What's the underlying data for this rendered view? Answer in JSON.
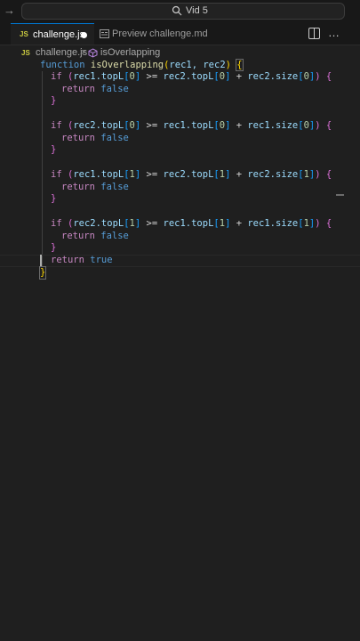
{
  "titlebar": {
    "back_arrow": "→",
    "command_center_label": "Vid 5"
  },
  "tabs": [
    {
      "icon": "JS",
      "label": "challenge.js",
      "dirty": true
    },
    {
      "label": "Preview challenge.md"
    }
  ],
  "tab_actions": {
    "more": "…"
  },
  "breadcrumb": {
    "icon": "JS",
    "file": "challenge.js",
    "separator": ">",
    "symbol": "isOverlapping"
  },
  "colors": {
    "accent": "#0078d4",
    "keyword": "#569cd6",
    "control": "#c586c0",
    "function": "#dcdcaa",
    "variable": "#9cdcfe",
    "number": "#b5cea8",
    "bracket_yellow": "#ffd700",
    "bracket_purple": "#da70d6",
    "bracket_blue": "#179fff"
  },
  "code": {
    "kw_function": "function",
    "fn_name": "isOverlapping",
    "params": "rec1, rec2",
    "kw_if": "if",
    "kw_return": "return",
    "val_false": "false",
    "val_true": "true",
    "cond1": {
      "a": "rec1.topL",
      "ai": "0",
      "b": "rec2.topL",
      "bi": "0",
      "c": "rec2.size",
      "ci": "0"
    },
    "cond2": {
      "a": "rec2.topL",
      "ai": "0",
      "b": "rec1.topL",
      "bi": "0",
      "c": "rec1.size",
      "ci": "0"
    },
    "cond3": {
      "a": "rec1.topL",
      "ai": "1",
      "b": "rec2.topL",
      "bi": "1",
      "c": "rec2.size",
      "ci": "1"
    },
    "cond4": {
      "a": "rec2.topL",
      "ai": "1",
      "b": "rec1.topL",
      "bi": "1",
      "c": "rec1.size",
      "ci": "1"
    }
  }
}
